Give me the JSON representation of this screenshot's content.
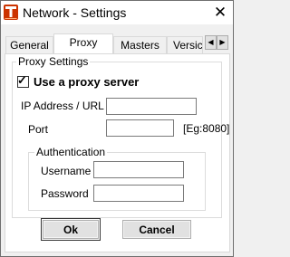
{
  "window": {
    "title": "Network - Settings",
    "close_glyph": "✕",
    "app_icon": "tally-logo-icon"
  },
  "tabs": [
    {
      "label": "General",
      "active": false
    },
    {
      "label": "Proxy",
      "active": true
    },
    {
      "label": "Masters",
      "active": false
    },
    {
      "label": "Versic",
      "active": false
    }
  ],
  "tab_scroll": {
    "left_glyph": "◀",
    "right_glyph": "▶"
  },
  "proxy_settings": {
    "group_title": "Proxy Settings",
    "use_proxy_label": "Use a proxy server",
    "use_proxy_checked": true,
    "check_glyph": "✓",
    "ip_label": "IP Address / URL",
    "ip_value": "",
    "port_label": "Port",
    "port_value": "",
    "port_hint": "[Eg:8080]"
  },
  "authentication": {
    "group_title": "Authentication",
    "username_label": "Username",
    "username_value": "",
    "password_label": "Password",
    "password_value": ""
  },
  "buttons": {
    "ok_label": "Ok",
    "cancel_label": "Cancel"
  },
  "colors": {
    "icon_bg": "#cc3300",
    "icon_fg": "#ffffff",
    "panel_bg": "#ffffff",
    "dialog_bg": "#f0f0f0"
  }
}
